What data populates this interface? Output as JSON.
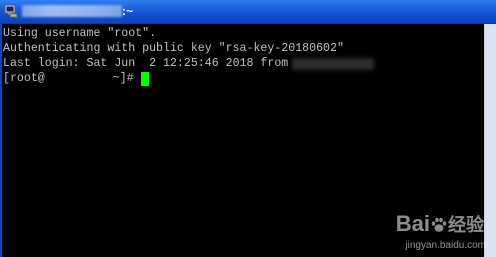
{
  "window": {
    "title_suffix": ":~",
    "icon": "putty-terminal-icon"
  },
  "terminal": {
    "line1": "Using username \"root\".",
    "line2": "Authenticating with public key \"rsa-key-20180602\"",
    "line3_prefix": "Last login: Sat Jun  2 12:25:46 2018 from",
    "line4_prefix": "[root@",
    "line4_suffix": "~]#",
    "cursor_color": "#00ff00",
    "text_color": "#c0c0c0"
  },
  "watermark": {
    "logo_text": "Bai",
    "logo_text_2": "经验",
    "url": "jingyan.baidu.com"
  }
}
